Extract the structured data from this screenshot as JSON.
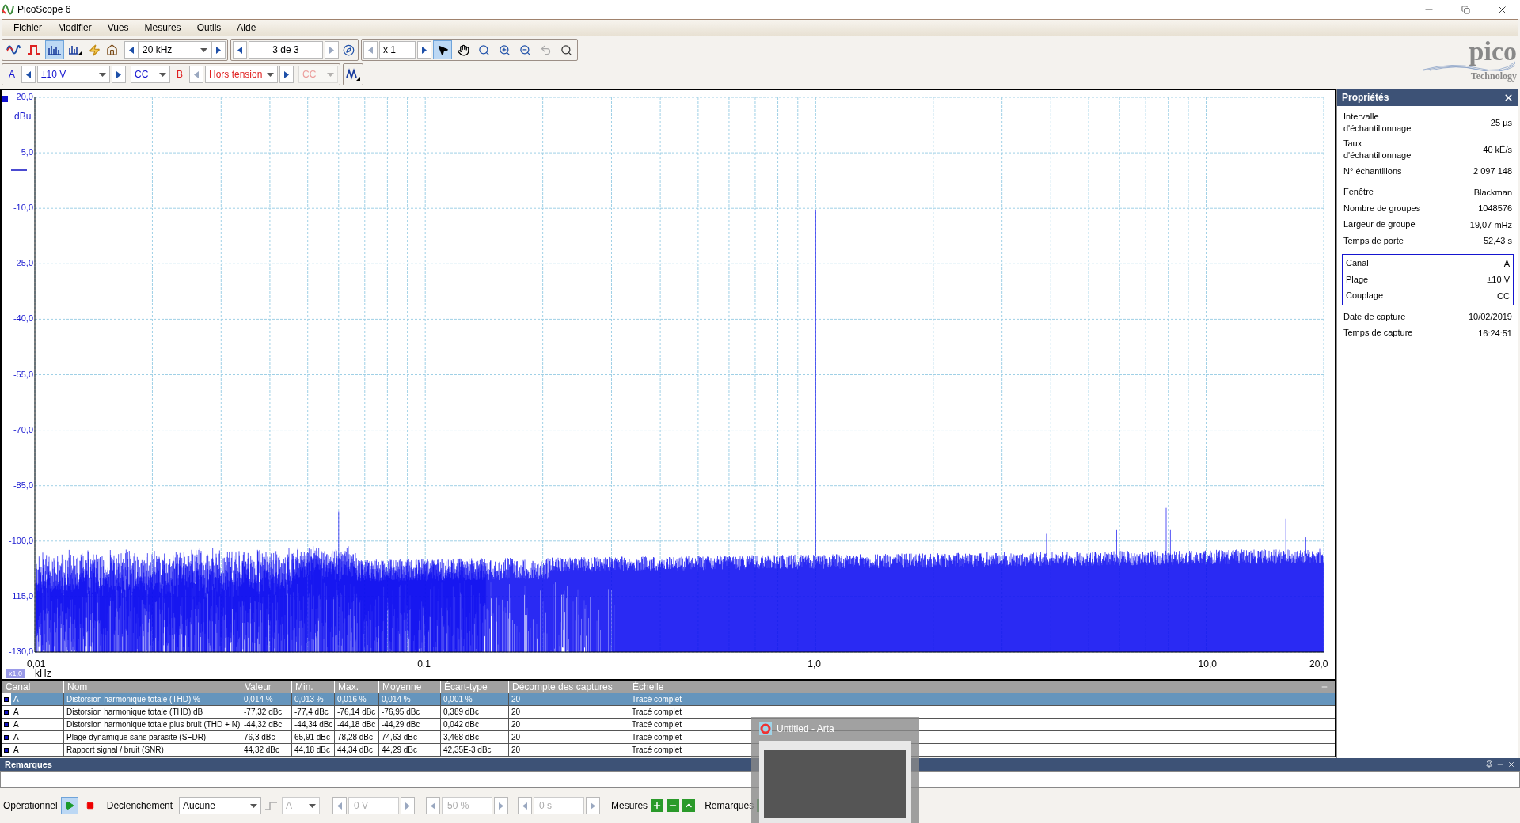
{
  "window": {
    "title": "PicoScope 6"
  },
  "menu": [
    "Fichier",
    "Modifier",
    "Vues",
    "Mesures",
    "Outils",
    "Aide"
  ],
  "view_modes": [
    {
      "kind": "scope",
      "selected": false
    },
    {
      "kind": "persistence",
      "selected": false
    },
    {
      "kind": "spectrum",
      "selected": true
    },
    {
      "kind": "spectrum-options",
      "selected": false
    }
  ],
  "timebase": "20 kHz",
  "buffer": "3 de 3",
  "zoom_factor": "x 1",
  "tools": [
    {
      "kind": "pointer",
      "selected": true
    },
    {
      "kind": "hand",
      "selected": false
    },
    {
      "kind": "zoom",
      "selected": false
    },
    {
      "kind": "zoom-in",
      "selected": false
    },
    {
      "kind": "zoom-out",
      "selected": false
    },
    {
      "kind": "undo",
      "selected": false
    },
    {
      "kind": "zoom-fit",
      "selected": false
    }
  ],
  "channels": [
    {
      "label": "A",
      "range": "±10 V",
      "coupling": "CC",
      "enabled": true
    },
    {
      "label": "B",
      "range": "Hors tension",
      "coupling": "CC",
      "enabled": false
    }
  ],
  "chart": {
    "y_unit": "dBu",
    "y_ticks": [
      "20,0",
      "5,0",
      "-10,0",
      "-25,0",
      "-40,0",
      "-55,0",
      "-70,0",
      "-85,0",
      "-100,0",
      "-115,0",
      "-130,0"
    ],
    "x_ticks": [
      "0,01",
      "0,1",
      "1,0",
      "10,0",
      "20,0"
    ],
    "x_scale": "x1,0",
    "x_unit": "kHz"
  },
  "properties": {
    "title": "Propriétés",
    "items": [
      {
        "label": "Intervalle d'échantillonnage",
        "value": "25 µs"
      },
      {
        "label": "Taux d'échantillonnage",
        "value": "40 kÉ/s"
      },
      {
        "label": "N° échantillons",
        "value": "2 097 148"
      },
      {
        "label": "Fenêtre",
        "value": "Blackman"
      },
      {
        "label": "Nombre de groupes",
        "value": "1048576"
      },
      {
        "label": "Largeur de groupe",
        "value": "19,07 mHz"
      },
      {
        "label": "Temps de porte",
        "value": "52,43 s"
      }
    ],
    "channel_box": [
      {
        "label": "Canal",
        "value": "A"
      },
      {
        "label": "Plage",
        "value": "±10 V"
      },
      {
        "label": "Couplage",
        "value": "CC"
      }
    ],
    "capture": [
      {
        "label": "Date de capture",
        "value": "10/02/2019"
      },
      {
        "label": "Temps de capture",
        "value": "16:24:51"
      }
    ]
  },
  "table": {
    "columns": [
      "Canal",
      "Nom",
      "Valeur",
      "Min.",
      "Max.",
      "Moyenne",
      "Écart-type",
      "Décompte des captures",
      "Échelle"
    ],
    "rows": [
      {
        "selected": true,
        "cells": [
          "A",
          "Distorsion harmonique totale (THD) %",
          "0,014 %",
          "0,013 %",
          "0,016 %",
          "0,014 %",
          "0,001 %",
          "20",
          "Tracé complet"
        ]
      },
      {
        "selected": false,
        "cells": [
          "A",
          "Distorsion harmonique totale (THD) dB",
          "-77,32 dBc",
          "-77,4 dBc",
          "-76,14 dBc",
          "-76,95 dBc",
          "0,389 dBc",
          "20",
          "Tracé complet"
        ]
      },
      {
        "selected": false,
        "cells": [
          "A",
          "Distorsion harmonique totale plus bruit (THD + N)",
          "-44,32 dBc",
          "-44,34 dBc",
          "-44,18 dBc",
          "-44,29 dBc",
          "0,042 dBc",
          "20",
          "Tracé complet"
        ]
      },
      {
        "selected": false,
        "cells": [
          "A",
          "Plage dynamique sans parasite (SFDR)",
          "76,3 dBc",
          "65,91 dBc",
          "78,28 dBc",
          "74,63 dBc",
          "3,468 dBc",
          "20",
          "Tracé complet"
        ]
      },
      {
        "selected": false,
        "cells": [
          "A",
          "Rapport signal / bruit (SNR)",
          "44,32 dBc",
          "44,18 dBc",
          "44,34 dBc",
          "44,29 dBc",
          "42,35E-3 dBc",
          "20",
          "Tracé complet"
        ]
      }
    ]
  },
  "notes": {
    "title": "Remarques"
  },
  "bottom_bar": {
    "status": "Opérationnel",
    "trigger_label": "Déclenchement",
    "trigger": "Aucune",
    "trigger_channel": "A",
    "threshold": "0 V",
    "pretrigger": "50 %",
    "delay": "0 s",
    "measures_label": "Mesures",
    "notes_label": "Remarques"
  },
  "task_preview": {
    "title": "Untitled - Arta"
  },
  "logo": {
    "name": "pico",
    "tagline": "Technology"
  }
}
